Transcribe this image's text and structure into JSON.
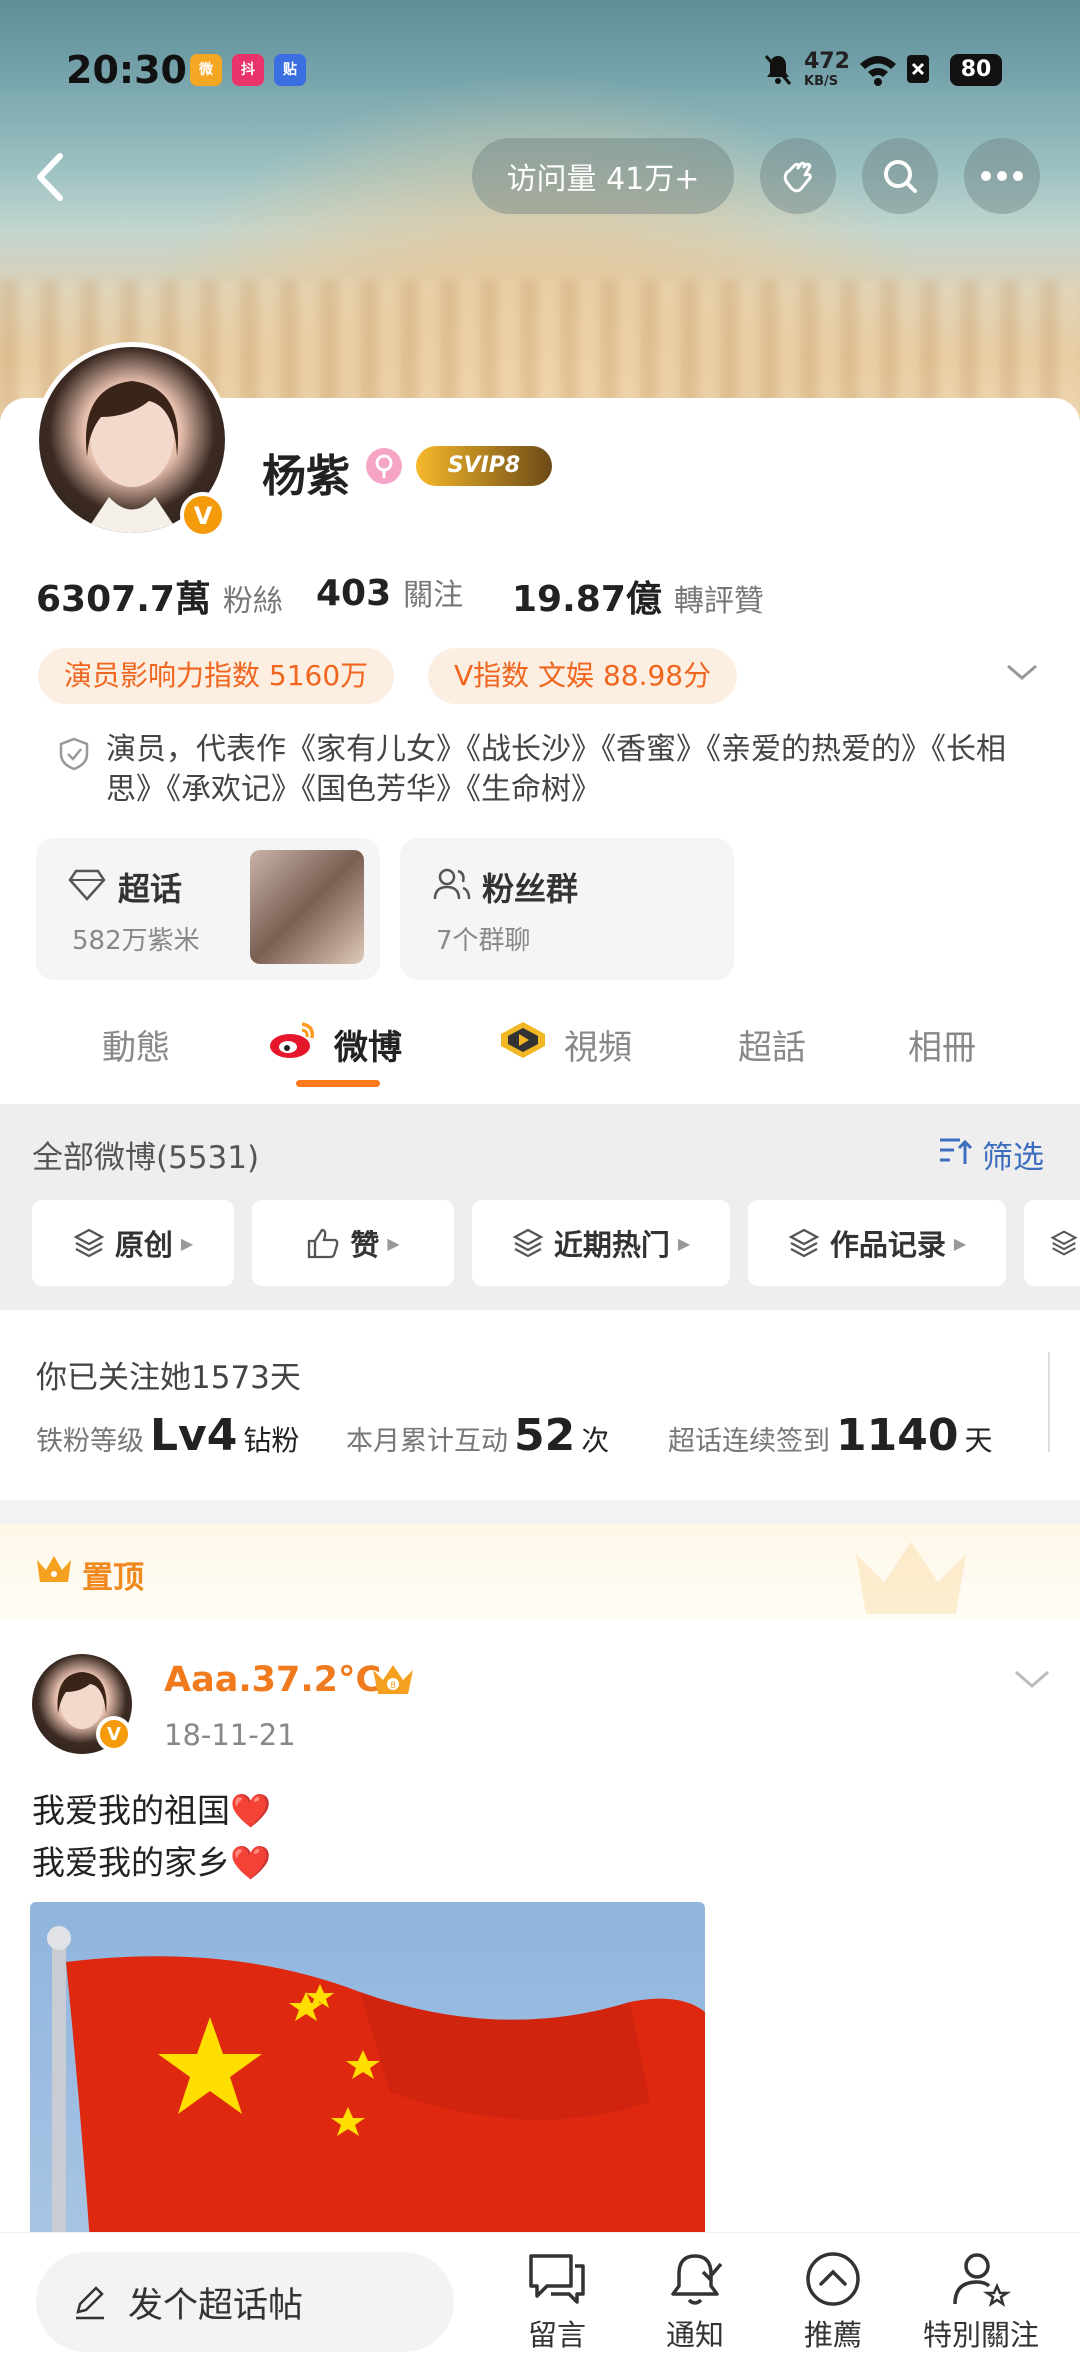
{
  "status_bar": {
    "time": "20:30",
    "net_speed": "472",
    "net_unit": "KB/S",
    "battery": "80",
    "app_icons": [
      "weibo-icon",
      "douyin-icon",
      "tieba-icon"
    ]
  },
  "header": {
    "visits": "访问量 41万+"
  },
  "profile": {
    "name": "杨紫",
    "vip_badge": "SVIP8",
    "stats": [
      {
        "value": "6307.7萬",
        "label": "粉絲"
      },
      {
        "value": "403",
        "label": "關注"
      },
      {
        "value": "19.87億",
        "label": "轉評贊"
      }
    ],
    "pills": [
      "演员影响力指数 5160万",
      "V指数 文娱 88.98分"
    ],
    "bio": "演员，代表作《家有儿女》《战长沙》《香蜜》《亲爱的热爱的》《长相思》《承欢记》《国色芳华》《生命树》",
    "chaohua": {
      "title": "超话",
      "sub": "582万紫米"
    },
    "fan_group": {
      "title": "粉丝群",
      "sub": "7个群聊"
    }
  },
  "tabs": [
    "動態",
    "微博",
    "視頻",
    "超話",
    "相冊"
  ],
  "feed_header": {
    "title": "全部微博(5531)",
    "filter": "筛选",
    "chips": [
      "原创",
      "赞",
      "近期热门",
      "作品记录"
    ]
  },
  "follow_info": {
    "title": "你已关注她1573天",
    "level_label": "铁粉等级",
    "level": "Lv4",
    "level_unit": "钻粉",
    "interact_label": "本月累计互动",
    "interact_value": "52",
    "interact_unit": "次",
    "checkin_label": "超话连续签到",
    "checkin_value": "1140",
    "checkin_unit": "天"
  },
  "pinned": {
    "label": "置顶",
    "author": "Aaa.37.2°C",
    "date": "18-11-21",
    "line1": "我爱我的祖国❤️",
    "line2": "我爱我的家乡❤️"
  },
  "bottom_bar": {
    "compose": "发个超话帖",
    "items": [
      "留言",
      "通知",
      "推薦",
      "特別關注"
    ]
  },
  "colors": {
    "accent": "#ff7a1a",
    "link": "#3d6dbd",
    "pill_bg": "#fdeee2"
  }
}
